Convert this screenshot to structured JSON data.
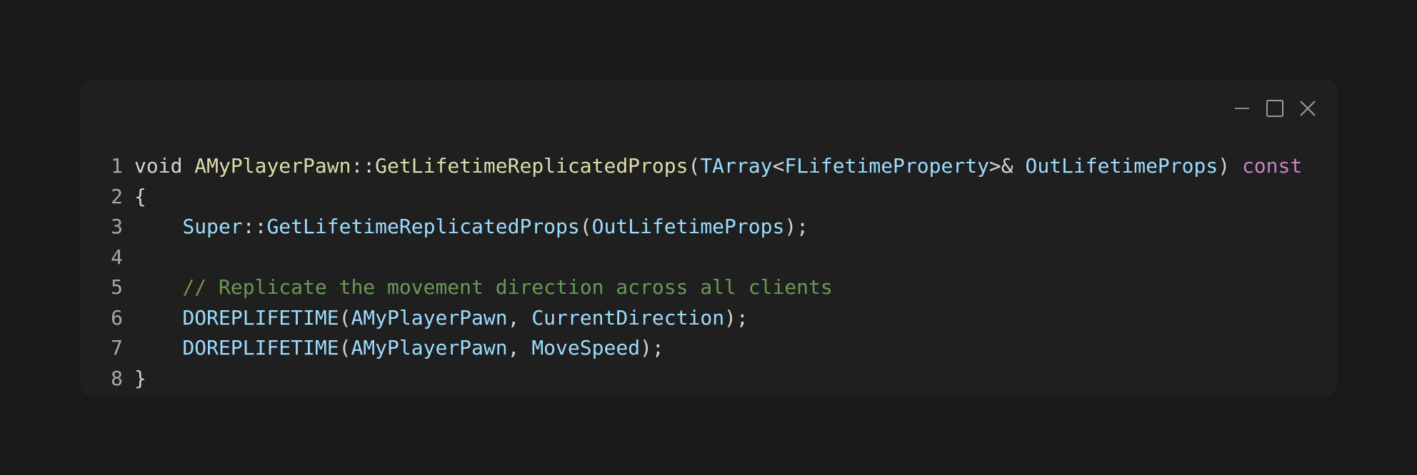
{
  "window": {
    "controls": [
      "minimize-icon",
      "maximize-icon",
      "close-icon"
    ],
    "colors": {
      "page_background": "#191919",
      "window_background": "#1f1f1f",
      "keyword_pink": "#c586c0",
      "comment_green": "#6a9955",
      "identifier_blue": "#9cdcfe",
      "function_yellow": "#dcdcaa"
    }
  },
  "code": {
    "language": "C++",
    "lines": [
      {
        "number": "1",
        "tokens": [
          {
            "text": "void ",
            "kind": "kw"
          },
          {
            "text": "AMyPlayerPawn",
            "kind": "cls"
          },
          {
            "text": "::",
            "kind": "punc"
          },
          {
            "text": "GetLifetimeReplicatedProps",
            "kind": "fn"
          },
          {
            "text": "(",
            "kind": "punc"
          },
          {
            "text": "TArray",
            "kind": "typ"
          },
          {
            "text": "<",
            "kind": "punc"
          },
          {
            "text": "FLifetimeProperty",
            "kind": "typ"
          },
          {
            "text": ">& ",
            "kind": "punc"
          },
          {
            "text": "OutLifetimeProps",
            "kind": "var"
          },
          {
            "text": ") ",
            "kind": "punc"
          },
          {
            "text": "const",
            "kind": "pink"
          }
        ]
      },
      {
        "number": "2",
        "tokens": [
          {
            "text": "{",
            "kind": "punc"
          }
        ]
      },
      {
        "number": "3",
        "tokens": [
          {
            "text": "    ",
            "kind": "punc"
          },
          {
            "text": "Super",
            "kind": "typ"
          },
          {
            "text": "::",
            "kind": "punc"
          },
          {
            "text": "GetLifetimeReplicatedProps",
            "kind": "var"
          },
          {
            "text": "(",
            "kind": "punc"
          },
          {
            "text": "OutLifetimeProps",
            "kind": "var"
          },
          {
            "text": ");",
            "kind": "punc"
          }
        ]
      },
      {
        "number": "4",
        "tokens": [
          {
            "text": "",
            "kind": "punc"
          }
        ]
      },
      {
        "number": "5",
        "tokens": [
          {
            "text": "    ",
            "kind": "punc"
          },
          {
            "text": "// Replicate the movement direction across all clients",
            "kind": "cmt"
          }
        ]
      },
      {
        "number": "6",
        "tokens": [
          {
            "text": "    ",
            "kind": "punc"
          },
          {
            "text": "DOREPLIFETIME",
            "kind": "mac"
          },
          {
            "text": "(",
            "kind": "punc"
          },
          {
            "text": "AMyPlayerPawn",
            "kind": "var"
          },
          {
            "text": ", ",
            "kind": "punc"
          },
          {
            "text": "CurrentDirection",
            "kind": "var"
          },
          {
            "text": ");",
            "kind": "punc"
          }
        ]
      },
      {
        "number": "7",
        "tokens": [
          {
            "text": "    ",
            "kind": "punc"
          },
          {
            "text": "DOREPLIFETIME",
            "kind": "mac"
          },
          {
            "text": "(",
            "kind": "punc"
          },
          {
            "text": "AMyPlayerPawn",
            "kind": "var"
          },
          {
            "text": ", ",
            "kind": "punc"
          },
          {
            "text": "MoveSpeed",
            "kind": "var"
          },
          {
            "text": ");",
            "kind": "punc"
          }
        ]
      },
      {
        "number": "8",
        "tokens": [
          {
            "text": "}",
            "kind": "punc"
          }
        ]
      }
    ]
  }
}
